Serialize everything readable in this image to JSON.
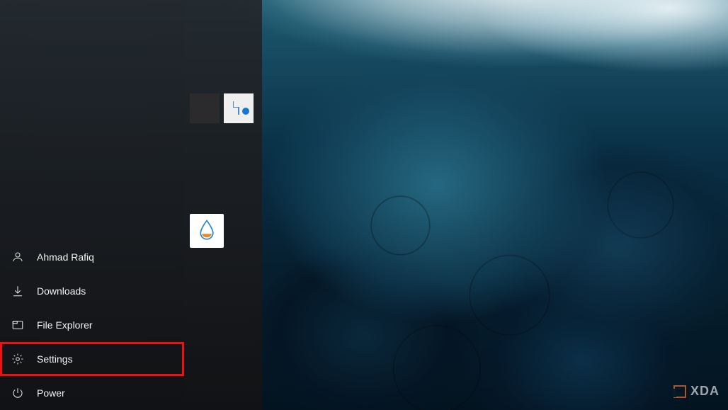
{
  "start_menu": {
    "user": {
      "name": "Ahmad Rafiq"
    },
    "items": {
      "downloads": "Downloads",
      "file_explorer": "File Explorer",
      "settings": "Settings",
      "power": "Power"
    }
  },
  "watermark": {
    "text": "XDA"
  },
  "highlight": {
    "color": "#e11111"
  }
}
